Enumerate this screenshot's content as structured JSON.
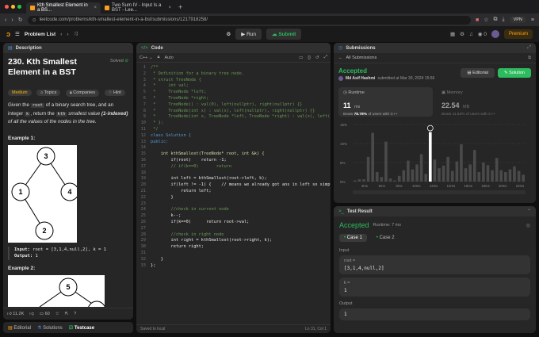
{
  "browser": {
    "tabs": [
      {
        "title": "Kth Smallest Element in a BS..."
      },
      {
        "title": "Two Sum IV - Input Is a BST - Lee..."
      }
    ],
    "url": "leetcode.com/problems/kth-smallest-element-in-a-bst/submissions/1217918258/",
    "vpn": "VPN"
  },
  "nav": {
    "problem_list": "Problem List",
    "run": "Run",
    "submit": "Submit",
    "streak": "0",
    "premium": "Premium"
  },
  "left": {
    "tab": "Description",
    "title": "230. Kth Smallest Element in a BST",
    "solved": "Solved",
    "difficulty": "Medium",
    "chips": [
      "Topics",
      "Companies",
      "Hint"
    ],
    "p1a": "Given the ",
    "root_code": "root",
    "p1b": " of a binary search tree, and an integer ",
    "k_code": "k",
    "p1c": ", return the ",
    "kth": "kth",
    "p1d": " smallest value ",
    "one_indexed": "(1-indexed)",
    "p1e": " of all the values of the nodes in the tree.",
    "ex1": "Example 1:",
    "ex1_input_label": "Input:",
    "ex1_input": "root = [3,1,4,null,2], k = 1",
    "ex1_output_label": "Output:",
    "ex1_output": "1",
    "ex2": "Example 2:",
    "tree1": [
      "3",
      "1",
      "4",
      "2"
    ],
    "tree2": [
      "5"
    ],
    "footer_stats": {
      "likes": "11.2K",
      "comments": "60"
    },
    "bottom_tabs": [
      "Editorial",
      "Solutions",
      "Testcase"
    ]
  },
  "code": {
    "tab": "Code",
    "lang": "C++",
    "auto": "Auto",
    "saved": "Saved to local",
    "cursor": "Ln 31, Col 1",
    "lines": [
      {
        "t": "/**",
        "c": "cc"
      },
      {
        "t": " * Definition for a binary tree node.",
        "c": "cc"
      },
      {
        "t": " * struct TreeNode {",
        "c": "cc"
      },
      {
        "t": " *     int val;",
        "c": "cc"
      },
      {
        "t": " *     TreeNode *left;",
        "c": "cc"
      },
      {
        "t": " *     TreeNode *right;",
        "c": "cc"
      },
      {
        "t": " *     TreeNode() : val(0), left(nullptr), right(nullptr) {}",
        "c": "cc"
      },
      {
        "t": " *     TreeNode(int x) : val(x), left(nullptr), right(nullptr) {}",
        "c": "cc"
      },
      {
        "t": " *     TreeNode(int x, TreeNode *left, TreeNode *right) : val(x), left(left), right(right) {}",
        "c": "cc"
      },
      {
        "t": " * };",
        "c": "cc"
      },
      {
        "t": " */",
        "c": "cc"
      },
      {
        "t": "class Solution {",
        "c": "kw"
      },
      {
        "t": "public:",
        "c": "kw"
      },
      {
        "t": "",
        "c": ""
      },
      {
        "t": "    int kthSmallest(TreeNode* root, int &k) {",
        "c": "fn"
      },
      {
        "t": "        if(root)    return -1;",
        "c": ""
      },
      {
        "t": "        // if(k==0)       return",
        "c": "cc"
      },
      {
        "t": "",
        "c": ""
      },
      {
        "t": "        int left = kthSmallest(root->left, k);",
        "c": ""
      },
      {
        "t": "        if(left != -1) {    // means we already got ans in left so simply return it",
        "c": ""
      },
      {
        "t": "            return left;",
        "c": ""
      },
      {
        "t": "        }",
        "c": ""
      },
      {
        "t": "",
        "c": ""
      },
      {
        "t": "        //check in current node",
        "c": "cc"
      },
      {
        "t": "        k--;",
        "c": ""
      },
      {
        "t": "        if(k==0)      return root->val;",
        "c": ""
      },
      {
        "t": "",
        "c": ""
      },
      {
        "t": "        //check in right node",
        "c": "cc"
      },
      {
        "t": "        int right = kthSmallest(root->right, k);",
        "c": ""
      },
      {
        "t": "        return right;",
        "c": ""
      },
      {
        "t": "",
        "c": ""
      },
      {
        "t": "    }",
        "c": ""
      },
      {
        "t": "};",
        "c": ""
      }
    ]
  },
  "submissions": {
    "tab": "Submissions",
    "all": "All Submissions",
    "status": "Accepted",
    "user": "Md Asif Hashmi",
    "submitted": "submitted at Mar 30, 2024 15:56",
    "editorial": "Editorial",
    "solution": "Solution",
    "runtime_label": "Runtime",
    "runtime_val": "11",
    "runtime_unit": "ms",
    "runtime_beats_label": "Beats",
    "runtime_beats": "78.78%",
    "runtime_beats_tail": "of users with C++",
    "memory_label": "Memory",
    "memory_val": "22.54",
    "memory_unit": "MB",
    "memory_beats_label": "Beats",
    "memory_beats": "11.52%",
    "memory_beats_tail": "of users with C++"
  },
  "chart_data": {
    "type": "bar",
    "ylabels": [
      "15%",
      "10%",
      "5%",
      "0%"
    ],
    "ylim": [
      0,
      15
    ],
    "categories": [
      "4ms",
      "6ms",
      "8ms",
      "10ms",
      "12ms",
      "14ms",
      "16ms",
      "18ms",
      "20ms",
      "22ms"
    ],
    "values": [
      0.3,
      0.6,
      0.6,
      6.5,
      12.8,
      2.5,
      1.2,
      10.5,
      0.8,
      0.3,
      1.5,
      3.0,
      5.5,
      3.2,
      4.5,
      7.2,
      2.0,
      13.0,
      5.8,
      3.5,
      4.2,
      6.5,
      2.8,
      5.3,
      9.8,
      3.5,
      4.5,
      8.3,
      2.5,
      5.0,
      4.3,
      3.0,
      6.2,
      3.0,
      2.5,
      3.2,
      4.0,
      2.8,
      1.8
    ],
    "highlight_index": 17,
    "colors": {
      "bar": "#4a4a4a",
      "highlight": "#ffffff"
    }
  },
  "test": {
    "tab": "Test Result",
    "status": "Accepted",
    "runtime": "Runtime: 7 ms",
    "cases": [
      "Case 1",
      "Case 2"
    ],
    "input_label": "Input",
    "root_label": "root =",
    "root_val": "[3,1,4,null,2]",
    "k_label": "k =",
    "k_val": "1",
    "output_label": "Output",
    "output_val": "1"
  },
  "colors": {
    "accent": "#2cbb5d",
    "orange": "#ffa116",
    "bg": "#0f0f0f",
    "panel": "#262626"
  }
}
